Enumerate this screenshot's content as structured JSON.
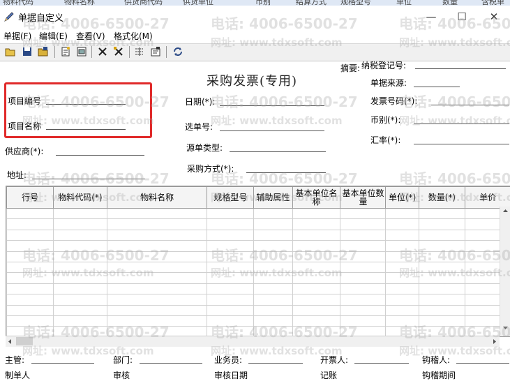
{
  "background_header": [
    "物料代码",
    "物料名称",
    "供货商代码",
    "供货单位",
    "币别",
    "结算方式",
    "规格型号",
    "单位",
    "数量",
    "含税单"
  ],
  "window": {
    "title": "单据自定义",
    "min_glyph": "—",
    "max_glyph": "☐",
    "close_glyph": "✕"
  },
  "menu": [
    "单据(F)",
    "编辑(E)",
    "查看(V)",
    "格式化(M)"
  ],
  "toolbar_icons": [
    "open-icon",
    "save-icon",
    "save-as-icon",
    "new-page-icon",
    "copy-icon",
    "delete-icon",
    "delete-all-icon",
    "insert-icon",
    "properties-icon",
    "refresh-icon"
  ],
  "form": {
    "title": "采购发票(专用)",
    "summary_label": "摘要:",
    "tax_label": "纳税登记号:",
    "source_label": "单据来源:",
    "project_no_label": "项目编号",
    "project_name_label": "项目名称",
    "date_label": "日期(*):",
    "invoice_no_label": "发票号码(*):",
    "currency_label": "币别(*):",
    "select_no_label": "选单号:",
    "supplier_label": "供应商(*):",
    "rate_label": "汇率(*):",
    "source_type_label": "源单类型:",
    "address_label": "地址:",
    "purchase_method_label": "采购方式(*):"
  },
  "table": {
    "columns": [
      "行号",
      "物料代码(*)",
      "物料名称",
      "规格型号",
      "辅助属性",
      "基本单位名称",
      "基本单位数量",
      "单位(*)",
      "数量(*)",
      "单价"
    ],
    "rows": 12
  },
  "footer": {
    "manager_label": "主管:",
    "dept_label": "部门:",
    "salesman_label": "业务员:",
    "issuer_label": "开票人:",
    "hook_label": "钩稽人:",
    "row2": [
      "制单人",
      "审核",
      "审核日期",
      "记账",
      "钩稽期间"
    ]
  },
  "watermark": {
    "phone": "电话: 4006-6500-27",
    "site": "网址: www.tdxsoft.com"
  },
  "highlight_color": "#e02a2a"
}
